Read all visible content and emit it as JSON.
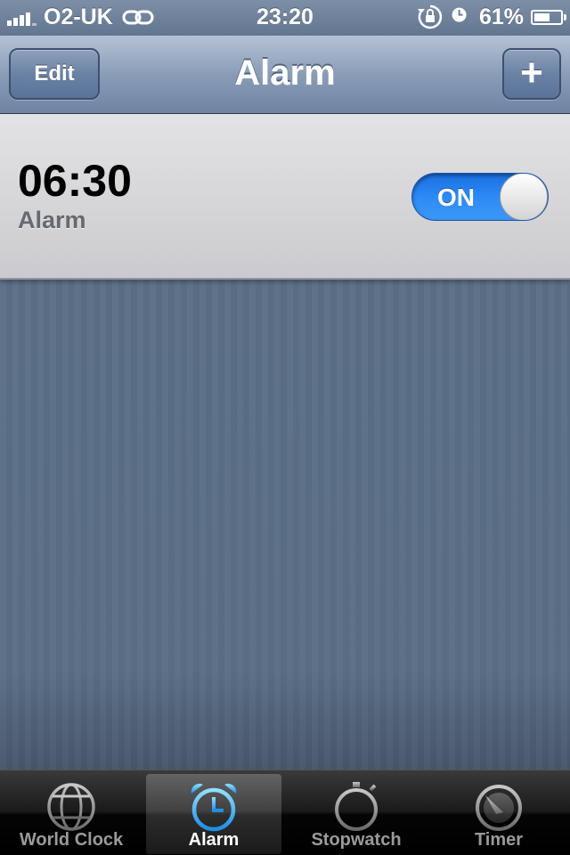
{
  "status_bar": {
    "carrier": "O2-UK",
    "time": "23:20",
    "battery_percent": "61%",
    "battery_level": 0.61,
    "icons": [
      "signal-icon",
      "sync-icon",
      "rotation-lock-icon",
      "alarm-clock-icon",
      "battery-icon"
    ]
  },
  "nav": {
    "title": "Alarm",
    "edit_label": "Edit",
    "add_label": "+"
  },
  "alarms": [
    {
      "time": "06:30",
      "label": "Alarm",
      "toggle_label": "ON",
      "enabled": true
    }
  ],
  "tabs": [
    {
      "label": "World Clock",
      "icon": "globe-icon",
      "selected": false
    },
    {
      "label": "Alarm",
      "icon": "alarm-clock-icon",
      "selected": true
    },
    {
      "label": "Stopwatch",
      "icon": "stopwatch-icon",
      "selected": false
    },
    {
      "label": "Timer",
      "icon": "timer-icon",
      "selected": false
    }
  ],
  "colors": {
    "toggle_on": "#2c8af5",
    "tab_selected": "#ffffff",
    "nav_bar": "#8a9db7"
  }
}
